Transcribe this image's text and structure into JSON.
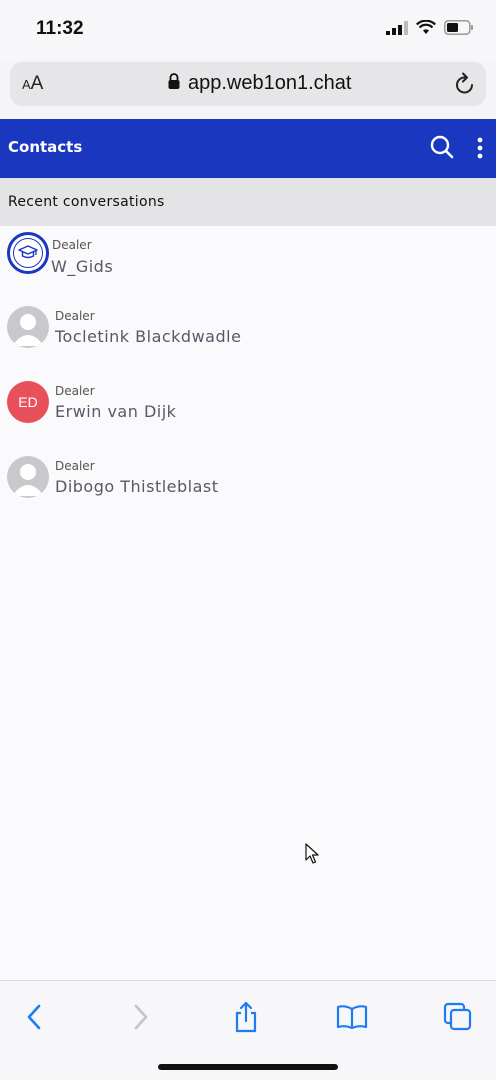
{
  "status_bar": {
    "time": "11:32"
  },
  "browser": {
    "text_size_small": "A",
    "text_size_big": "A",
    "url": "app.web1on1.chat"
  },
  "header": {
    "title": "Contacts"
  },
  "section": {
    "title": "Recent conversations"
  },
  "contacts": [
    {
      "role": "Dealer",
      "name": "W_Gids",
      "avatar": "graduation-cap-logo"
    },
    {
      "role": "Dealer",
      "name": "Tocletink Blackdwadle",
      "avatar": "default-person"
    },
    {
      "role": "Dealer",
      "name": "Erwin van Dijk",
      "avatar": "initials",
      "initials": "ED"
    },
    {
      "role": "Dealer",
      "name": "Dibogo Thistleblast",
      "avatar": "default-person"
    }
  ],
  "colors": {
    "brand_blue": "#1a37c0",
    "initials_red": "#e8505b",
    "ios_blue": "#1e7cf2"
  },
  "toolbar": {
    "icons": [
      "back-icon",
      "forward-icon",
      "share-icon",
      "bookmarks-icon",
      "tabs-icon"
    ]
  }
}
